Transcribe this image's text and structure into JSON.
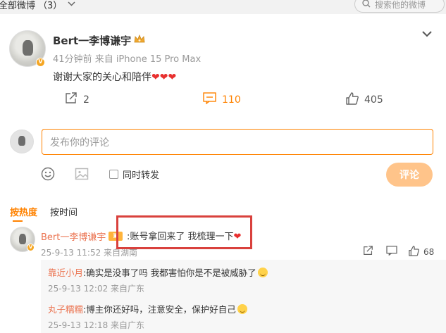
{
  "filter": {
    "label": "全部微博",
    "count": "（3）"
  },
  "search": {
    "placeholder": "搜索他的微博"
  },
  "post": {
    "author": "Bert一李博谦宇",
    "time": "41分钟前",
    "source": "来自 iPhone 15 Pro Max",
    "text": "谢谢大家的关心和陪伴",
    "hearts": "❤❤❤",
    "share_count": "2",
    "comment_count": "110",
    "like_count": "405"
  },
  "composer": {
    "placeholder": "发布你的评论",
    "forward_label": "同时转发",
    "submit_label": "评论"
  },
  "sort": {
    "hot": "按热度",
    "time": "按时间"
  },
  "top_comment": {
    "name": "Bert一李博谦宇",
    "badge": "▣",
    "text": ":账号拿回来了 我梳理一下",
    "heart": "❤",
    "time": "25-9-13 11:52 来自湖南",
    "like_count": "68"
  },
  "replies": [
    {
      "name": "靠近小月",
      "text": ":确实是没事了吗 我都害怕你是不是被威胁了",
      "time": "25-9-13 12:02 来自广东"
    },
    {
      "name": "丸子糯糯",
      "text": ":博主你还好吗，注意安全，保护好自己",
      "time": "25-9-13 12:18 来自广东"
    }
  ],
  "colors": {
    "accent": "#ff8200",
    "name": "#eb7350",
    "highlight": "#d9413d",
    "heart": "#e8302f"
  }
}
